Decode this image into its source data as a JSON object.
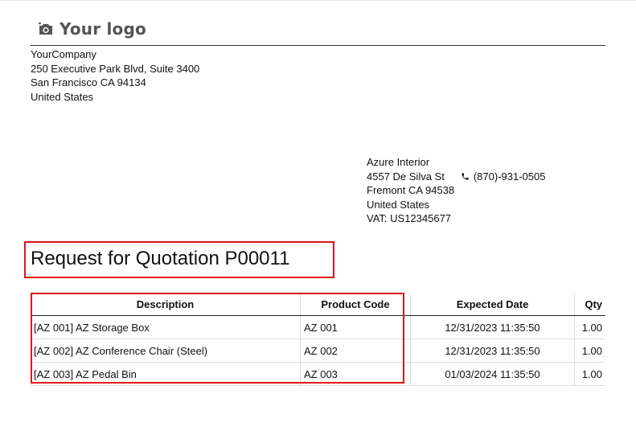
{
  "logo": {
    "icon": "camera-icon",
    "text": "Your logo"
  },
  "company": {
    "name": "YourCompany",
    "street": "250 Executive Park Blvd, Suite 3400",
    "city": "San Francisco CA 94134",
    "country": "United States"
  },
  "partner": {
    "name": "Azure Interior",
    "street": "4557 De Silva St",
    "phone_icon": "phone-icon",
    "phone": "(870)-931-0505",
    "city": "Fremont CA 94538",
    "country": "United States",
    "vat": "VAT: US12345677"
  },
  "document": {
    "title": "Request for Quotation P00011"
  },
  "table": {
    "headers": [
      "Description",
      "Product Code",
      "Expected Date",
      "Qty"
    ],
    "rows": [
      [
        "[AZ 001] AZ Storage Box",
        "AZ 001",
        "12/31/2023 11:35:50",
        "1.00"
      ],
      [
        "[AZ 002] AZ Conference Chair (Steel)",
        "AZ 002",
        "12/31/2023 11:35:50",
        "1.00"
      ],
      [
        "[AZ 003] AZ Pedal Bin",
        "AZ 003",
        "01/03/2024 11:35:50",
        "1.00"
      ]
    ]
  },
  "colors": {
    "highlight": "#e0141c",
    "logo_text": "#555555"
  }
}
